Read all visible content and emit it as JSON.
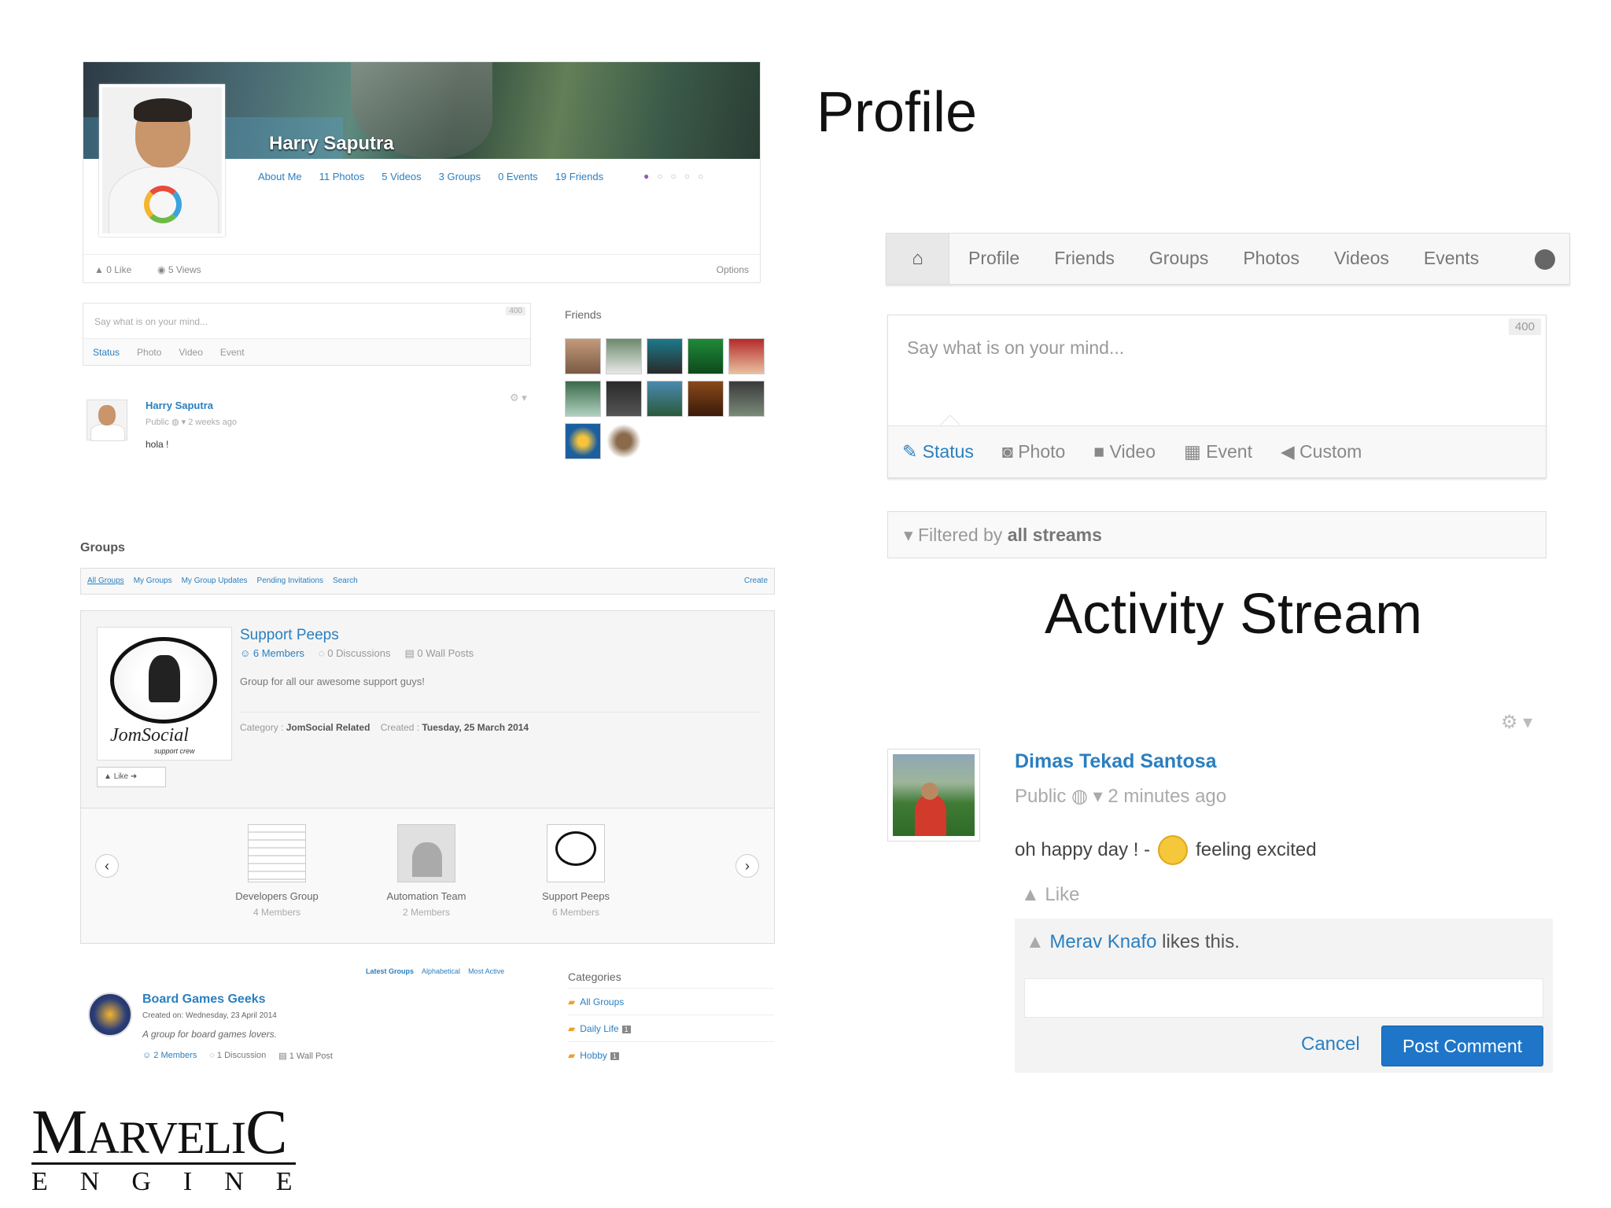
{
  "headings": {
    "profile": "Profile",
    "activity": "Activity Stream"
  },
  "profile": {
    "name": "Harry Saputra",
    "links": [
      "About Me",
      "11 Photos",
      "5 Videos",
      "3 Groups",
      "0 Events",
      "19 Friends"
    ],
    "likes": "0 Like",
    "views": "5 Views",
    "options": "Options"
  },
  "small_composer": {
    "placeholder": "Say what is on your mind...",
    "counter": "400",
    "tabs": [
      "Status",
      "Photo",
      "Video",
      "Event"
    ]
  },
  "small_post": {
    "name": "Harry Saputra",
    "meta": "Public ◍ ▾ 2 weeks ago",
    "text": "hola !"
  },
  "friends": {
    "title": "Friends"
  },
  "groups": {
    "title": "Groups",
    "tabs": [
      "All Groups",
      "My Groups",
      "My Group Updates",
      "Pending Invitations",
      "Search"
    ],
    "create": "Create",
    "featured": {
      "name": "Support Peeps",
      "members": "6 Members",
      "discussions": "0 Discussions",
      "wall_posts": "0 Wall Posts",
      "description": "Group for all our awesome support guys!",
      "category_label": "Category :",
      "category": "JomSocial Related",
      "created_label": "Created :",
      "created": "Tuesday, 25 March 2014",
      "logo_brand": "JomSocial",
      "logo_sub": "support crew",
      "like": "Like"
    },
    "carousel": [
      {
        "name": "Developers Group",
        "members": "4 Members"
      },
      {
        "name": "Automation Team",
        "members": "2 Members"
      },
      {
        "name": "Support Peeps",
        "members": "6 Members"
      }
    ],
    "sort_links": [
      "Latest Groups",
      "Alphabetical",
      "Most Active"
    ],
    "list_item": {
      "name": "Board Games Geeks",
      "created": "Created on: Wednesday, 23 April 2014",
      "description": "A group for board games lovers.",
      "members": "2 Members",
      "discussions": "1 Discussion",
      "wall_posts": "1 Wall Post"
    },
    "categories_title": "Categories",
    "categories": [
      {
        "label": "All Groups",
        "count": ""
      },
      {
        "label": "Daily Life",
        "count": "1"
      },
      {
        "label": "Hobby",
        "count": "1"
      }
    ]
  },
  "brand": {
    "top_big": "M",
    "top_rest": "ARVELI",
    "top_big2": "C",
    "bottom": "ENGINE"
  },
  "nav": {
    "items": [
      "Profile",
      "Friends",
      "Groups",
      "Photos",
      "Videos",
      "Events"
    ]
  },
  "composer": {
    "placeholder": "Say what is on your mind...",
    "counter": "400",
    "tabs": [
      "Status",
      "Photo",
      "Video",
      "Event",
      "Custom"
    ]
  },
  "filter": {
    "prefix": "Filtered by",
    "value": "all streams"
  },
  "post": {
    "name": "Dimas Tekad Santosa",
    "meta": "Public ◍ ▾ 2 minutes ago",
    "text": "oh happy day ! -",
    "feeling": "feeling excited",
    "like": "Like",
    "liker": "Merav Knafo",
    "likes_suffix": "likes this.",
    "cancel": "Cancel",
    "post_comment": "Post Comment"
  },
  "colors": {
    "link": "#2a7fc0",
    "primary_button": "#1f76c8"
  }
}
